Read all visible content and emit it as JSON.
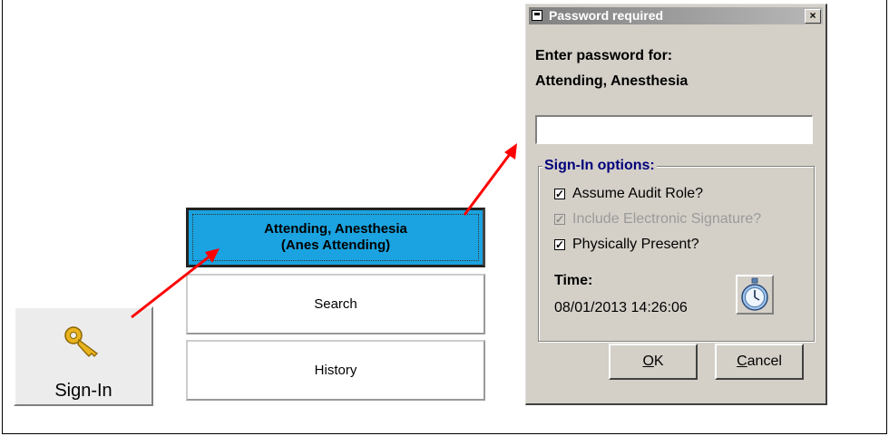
{
  "signin": {
    "label": "Sign-In",
    "icon": "key-icon"
  },
  "menu": {
    "attending_line1": "Attending, Anesthesia",
    "attending_line2": "(Anes Attending)",
    "search": "Search",
    "history": "History"
  },
  "dialog": {
    "title": "Password required",
    "close": "×",
    "prompt": "Enter password for:",
    "user": "Attending, Anesthesia",
    "password_value": "",
    "group_title": "Sign-In options:",
    "options": [
      {
        "label": "Assume Audit Role?",
        "checked": true,
        "enabled": true
      },
      {
        "label": "Include Electronic Signature?",
        "checked": true,
        "enabled": false
      },
      {
        "label": "Physically Present?",
        "checked": true,
        "enabled": true
      }
    ],
    "time_label": "Time:",
    "time_value": "08/01/2013 14:26:06",
    "ok_prefix": "",
    "ok_underline": "O",
    "ok_rest": "K",
    "cancel_underline": "C",
    "cancel_rest": "ancel"
  },
  "colors": {
    "accent": "#1aa3e0",
    "arrow": "#ff0000",
    "dialog_bg": "#d4d0c8"
  }
}
